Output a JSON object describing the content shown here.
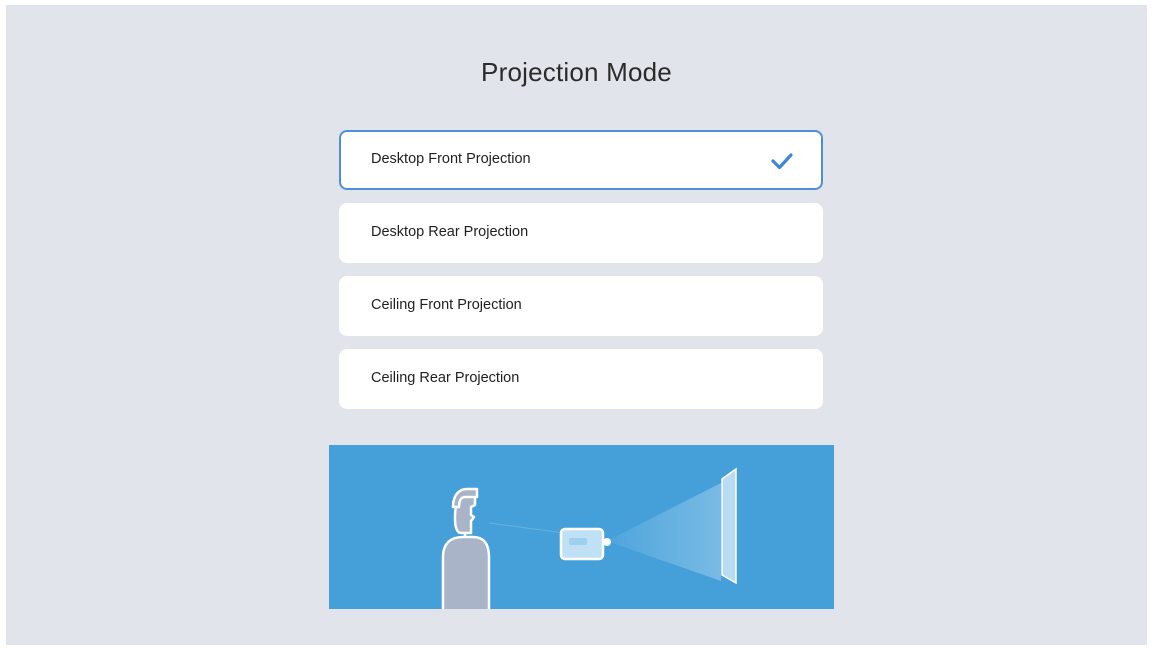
{
  "title": "Projection Mode",
  "options": [
    {
      "label": "Desktop Front Projection",
      "selected": true
    },
    {
      "label": "Desktop Rear Projection",
      "selected": false
    },
    {
      "label": "Ceiling Front Projection",
      "selected": false
    },
    {
      "label": "Ceiling Rear Projection",
      "selected": false
    }
  ],
  "icons": {
    "selected_indicator": "check-icon",
    "illustration": "projection-diagram"
  },
  "colors": {
    "background": "#e1e4ea",
    "accent": "#4f8ed9",
    "illustration_bg": "#45a0da"
  }
}
